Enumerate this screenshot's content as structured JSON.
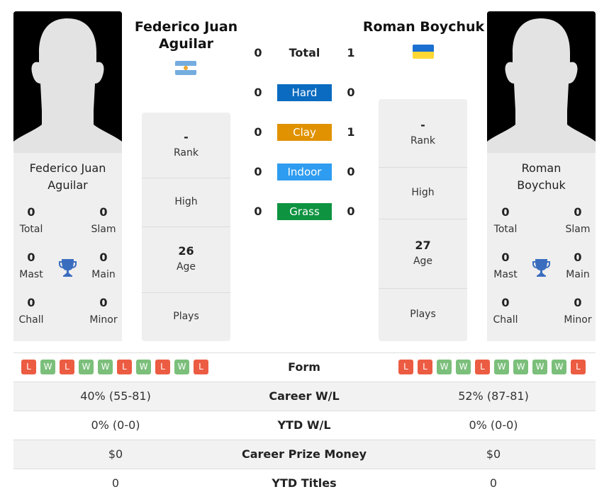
{
  "colors": {
    "hard": "#0a6bc0",
    "clay": "#e09200",
    "indoor": "#2e9cf0",
    "grass": "#0e9340",
    "win": "#7bbf7b",
    "loss": "#ec5c42",
    "trophy": "#3b6dbf"
  },
  "player1": {
    "name": "Federico Juan Aguilar",
    "name_line1": "Federico Juan",
    "name_line2": "Aguilar",
    "flag": "argentina-flag",
    "titles": {
      "total": {
        "value": "0",
        "label": "Total"
      },
      "slam": {
        "value": "0",
        "label": "Slam"
      },
      "mast": {
        "value": "0",
        "label": "Mast"
      },
      "main": {
        "value": "0",
        "label": "Main"
      },
      "chall": {
        "value": "0",
        "label": "Chall"
      },
      "minor": {
        "value": "0",
        "label": "Minor"
      }
    },
    "info": {
      "rank": {
        "value": "-",
        "label": "Rank"
      },
      "high": {
        "value": "",
        "label": "High"
      },
      "age": {
        "value": "26",
        "label": "Age"
      },
      "plays": {
        "value": "",
        "label": "Plays"
      }
    },
    "form": [
      "L",
      "W",
      "L",
      "W",
      "W",
      "L",
      "W",
      "L",
      "W",
      "L"
    ]
  },
  "player2": {
    "name": "Roman Boychuk",
    "name_line1": "Roman",
    "name_line2": "Boychuk",
    "flag": "ukraine-flag",
    "titles": {
      "total": {
        "value": "0",
        "label": "Total"
      },
      "slam": {
        "value": "0",
        "label": "Slam"
      },
      "mast": {
        "value": "0",
        "label": "Mast"
      },
      "main": {
        "value": "0",
        "label": "Main"
      },
      "chall": {
        "value": "0",
        "label": "Chall"
      },
      "minor": {
        "value": "0",
        "label": "Minor"
      }
    },
    "info": {
      "rank": {
        "value": "-",
        "label": "Rank"
      },
      "high": {
        "value": "",
        "label": "High"
      },
      "age": {
        "value": "27",
        "label": "Age"
      },
      "plays": {
        "value": "",
        "label": "Plays"
      }
    },
    "form": [
      "L",
      "L",
      "W",
      "W",
      "L",
      "W",
      "W",
      "W",
      "W",
      "L"
    ]
  },
  "h2h": [
    {
      "surface": "Total",
      "p1": "0",
      "p2": "1"
    },
    {
      "surface": "Hard",
      "p1": "0",
      "p2": "0"
    },
    {
      "surface": "Clay",
      "p1": "0",
      "p2": "1"
    },
    {
      "surface": "Indoor",
      "p1": "0",
      "p2": "0"
    },
    {
      "surface": "Grass",
      "p1": "0",
      "p2": "0"
    }
  ],
  "comparison": {
    "form_label": "Form",
    "rows": [
      {
        "label": "Career W/L",
        "p1": "40% (55-81)",
        "p2": "52% (87-81)"
      },
      {
        "label": "YTD W/L",
        "p1": "0% (0-0)",
        "p2": "0% (0-0)"
      },
      {
        "label": "Career Prize Money",
        "p1": "$0",
        "p2": "$0"
      },
      {
        "label": "YTD Titles",
        "p1": "0",
        "p2": "0"
      }
    ]
  }
}
